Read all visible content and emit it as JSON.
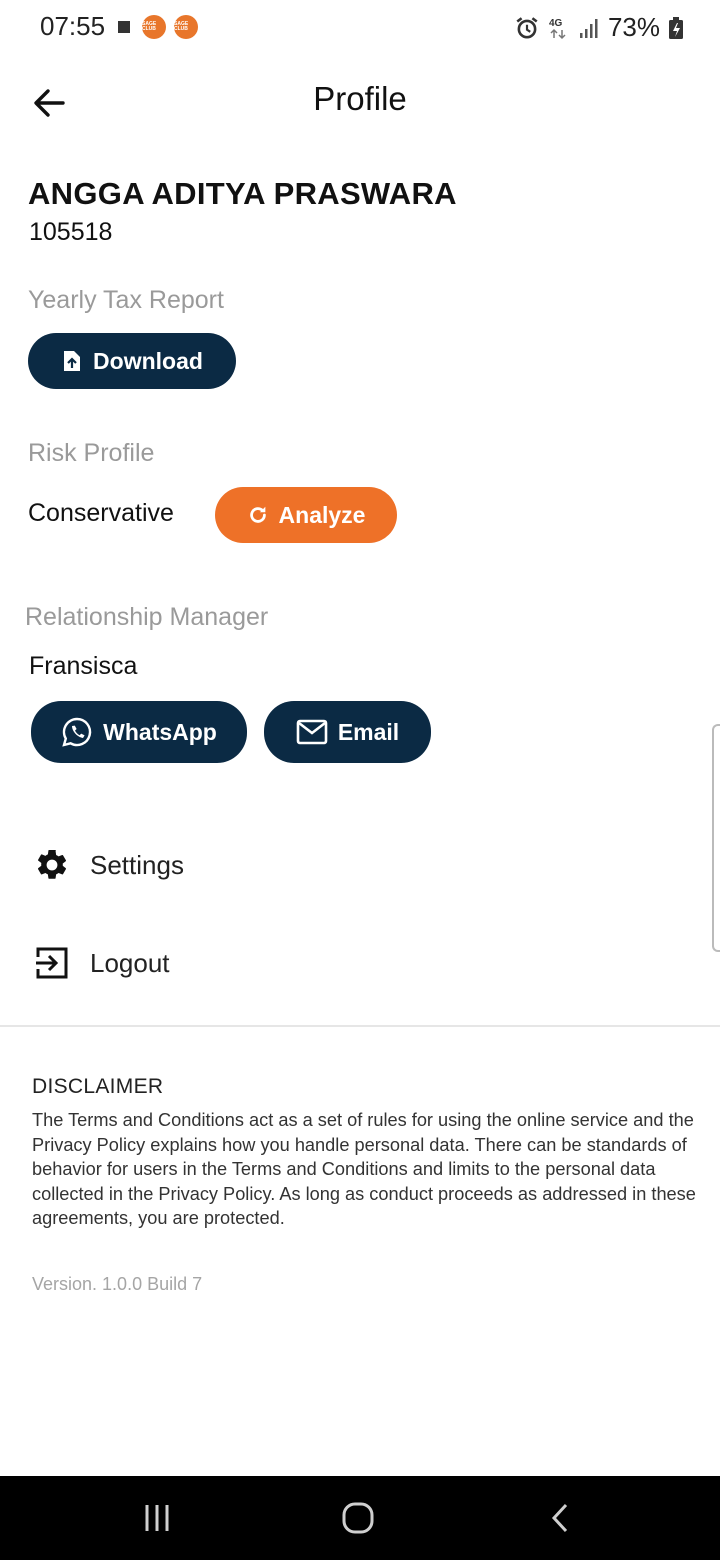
{
  "status_bar": {
    "time": "07:55",
    "battery_percent": "73%",
    "network": "4G",
    "app_badge_text": "SAGE CLUB"
  },
  "header": {
    "title": "Profile",
    "back_icon": "arrow-left-icon"
  },
  "profile": {
    "name": "ANGGA ADITYA PRASWARA",
    "id": "105518"
  },
  "tax_report": {
    "label": "Yearly Tax Report",
    "download_label": "Download",
    "icon": "file-upload-icon"
  },
  "risk_profile": {
    "label": "Risk Profile",
    "value": "Conservative",
    "analyze_label": "Analyze",
    "icon": "refresh-icon"
  },
  "relationship_manager": {
    "label": "Relationship Manager",
    "name": "Fransisca",
    "whatsapp_label": "WhatsApp",
    "email_label": "Email"
  },
  "menu": {
    "settings_label": "Settings",
    "logout_label": "Logout"
  },
  "disclaimer": {
    "title": "DISCLAIMER",
    "body": "The Terms and Conditions act as a set of rules for using the online service and the Privacy Policy explains how you handle personal data. There can be standards of behavior for users in the Terms and Conditions and limits to the personal data collected in the Privacy Policy. As long as conduct proceeds as addressed in these agreements, you are protected.",
    "version": "Version. 1.0.0 Build 7"
  },
  "colors": {
    "navy": "#0b2a44",
    "orange": "#ee7128",
    "label_gray": "#9a9a9a"
  }
}
